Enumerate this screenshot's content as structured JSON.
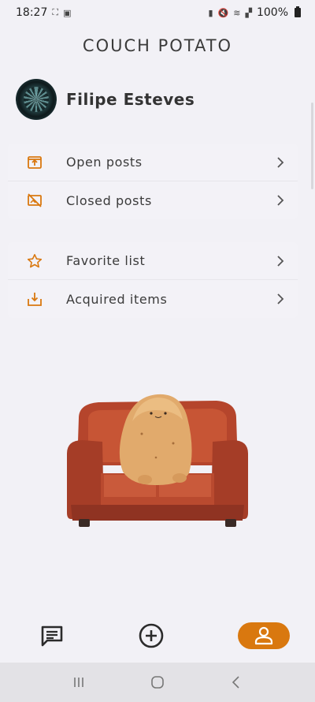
{
  "status_bar": {
    "time": "18:27",
    "battery": "100%"
  },
  "app": {
    "title": "COUCH POTATO"
  },
  "profile": {
    "name": "Filipe Esteves"
  },
  "menu_groups": [
    {
      "items": [
        {
          "label": "Open posts",
          "icon": "upload-box-icon"
        },
        {
          "label": "Closed posts",
          "icon": "slashed-image-icon"
        }
      ]
    },
    {
      "items": [
        {
          "label": "Favorite list",
          "icon": "star-outline-icon"
        },
        {
          "label": "Acquired items",
          "icon": "download-tray-icon"
        }
      ]
    }
  ],
  "bottom_nav": {
    "items": [
      "chat-icon",
      "add-circle-icon",
      "person-icon"
    ],
    "active": "person-icon"
  },
  "colors": {
    "accent": "#d9780f",
    "background": "#f2f1f6",
    "text": "#3b3b3b"
  }
}
